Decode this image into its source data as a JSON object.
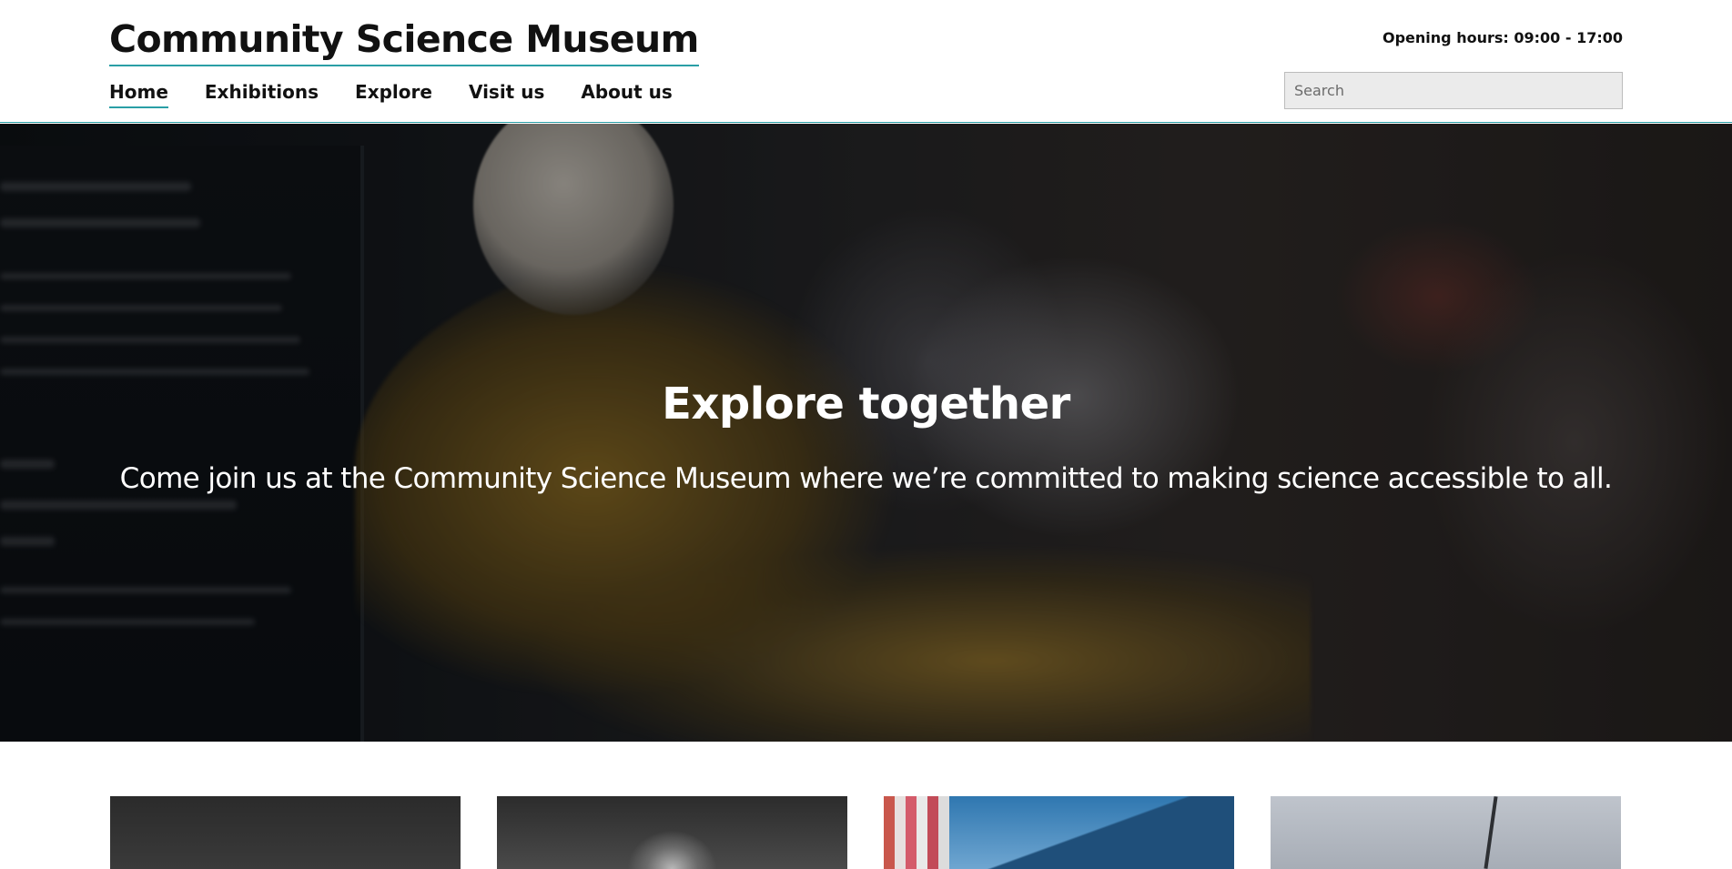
{
  "header": {
    "site_title": "Community Science Museum",
    "opening_hours": "Opening hours: 09:00 - 17:00",
    "search_placeholder": "Search",
    "nav": [
      {
        "label": "Home",
        "active": true
      },
      {
        "label": "Exhibitions",
        "active": false
      },
      {
        "label": "Explore",
        "active": false
      },
      {
        "label": "Visit us",
        "active": false
      },
      {
        "label": "About us",
        "active": false
      }
    ]
  },
  "hero": {
    "title": "Explore together",
    "subtitle": "Come join us at the Community Science Museum where we’re committed to making science accessible to all."
  },
  "colors": {
    "accent": "#2a9fa6",
    "search_bg": "#ebebeb",
    "text": "#111111"
  }
}
